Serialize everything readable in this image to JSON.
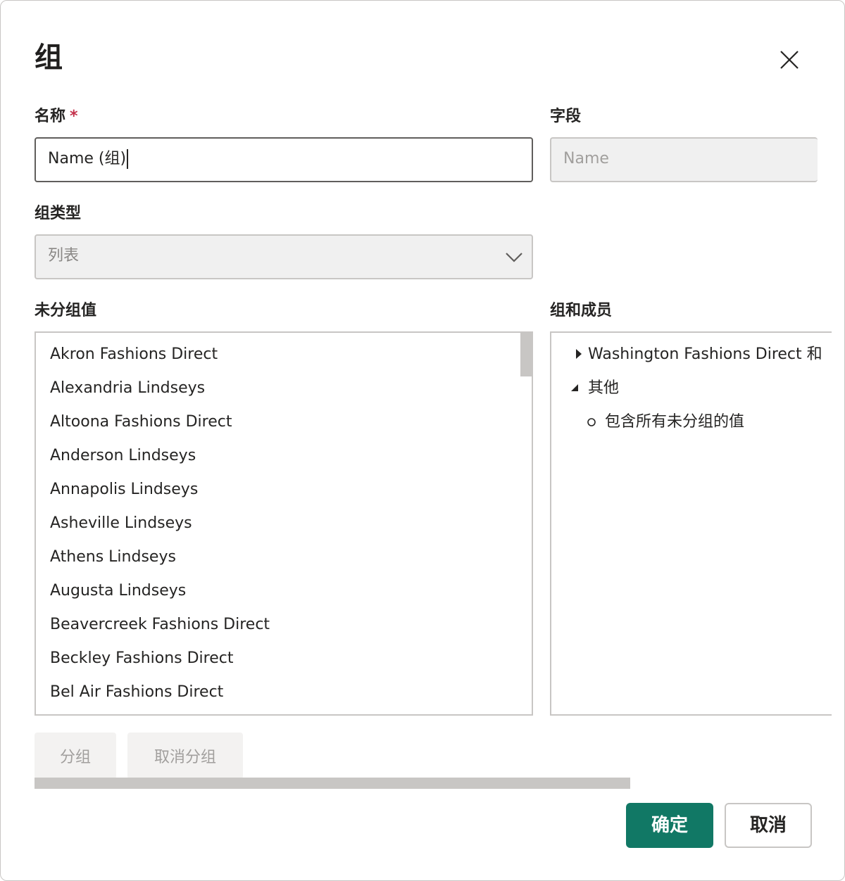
{
  "dialog": {
    "title": "组",
    "close_icon": "close-icon"
  },
  "name_field": {
    "label": "名称",
    "required_marker": "*",
    "value": "Name (组)"
  },
  "field_field": {
    "label": "字段",
    "placeholder": "Name"
  },
  "group_type": {
    "label": "组类型",
    "selected": "列表",
    "icon": "chevron-down-icon"
  },
  "ungrouped": {
    "label": "未分组值",
    "items": [
      "Akron Fashions Direct",
      "Alexandria Lindseys",
      "Altoona Fashions Direct",
      "Anderson Lindseys",
      "Annapolis Lindseys",
      "Asheville Lindseys",
      "Athens Lindseys",
      "Augusta Lindseys",
      "Beavercreek Fashions Direct",
      "Beckley Fashions Direct",
      "Bel Air Fashions Direct"
    ]
  },
  "groups": {
    "label": "组和成员",
    "tree": [
      {
        "label": "Washington Fashions Direct 和",
        "state": "collapsed"
      },
      {
        "label": "其他",
        "state": "expanded"
      },
      {
        "label": "包含所有未分组的值",
        "state": "leaf"
      }
    ]
  },
  "actions": {
    "group_label": "分组",
    "ungroup_label": "取消分组",
    "ok_label": "确定",
    "cancel_label": "取消"
  },
  "colors": {
    "primary": "#117865",
    "required": "#c4314b",
    "border": "#c8c6c4"
  }
}
